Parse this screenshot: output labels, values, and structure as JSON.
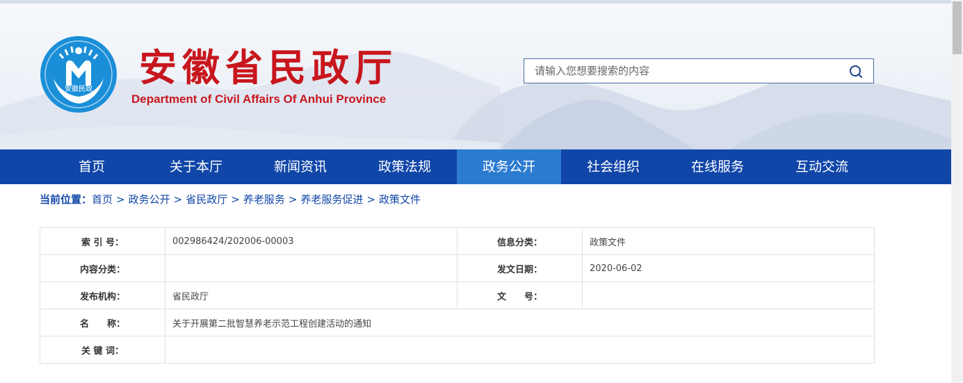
{
  "header": {
    "logo_text": "安徽民政",
    "title": "安徽省民政厅",
    "subtitle": "Department of Civil Affairs Of Anhui Province"
  },
  "search": {
    "placeholder": "请输入您想要搜索的内容",
    "icon": "search-icon"
  },
  "nav": {
    "items": [
      {
        "label": "首页"
      },
      {
        "label": "关于本厅"
      },
      {
        "label": "新闻资讯"
      },
      {
        "label": "政策法规"
      },
      {
        "label": "政务公开",
        "active": true
      },
      {
        "label": "社会组织"
      },
      {
        "label": "在线服务"
      },
      {
        "label": "互动交流"
      }
    ]
  },
  "breadcrumb": {
    "label": "当前位置：",
    "separator": ">",
    "items": [
      "首页",
      "政务公开",
      "省民政厅",
      "养老服务",
      "养老服务促进",
      "政策文件"
    ]
  },
  "info": {
    "index_label": "索 引 号：",
    "index_value": "002986424/202006-00003",
    "category_label": "信息分类：",
    "category_value": "政策文件",
    "content_label": "内容分类：",
    "content_value": "",
    "date_label": "发文日期：",
    "date_value": "2020-06-02",
    "issuer_label": "发布机构：",
    "issuer_value": "省民政厅",
    "docno_label": "文　　号：",
    "docno_value": "",
    "name_label": "名　　称：",
    "name_value": "关于开展第二批智慧养老示范工程创建活动的通知",
    "keywords_label": "关 键 词：",
    "keywords_value": ""
  },
  "colors": {
    "brand_red": "#c8161d",
    "nav_blue": "#1046a8",
    "nav_active": "#2b7bd0"
  }
}
